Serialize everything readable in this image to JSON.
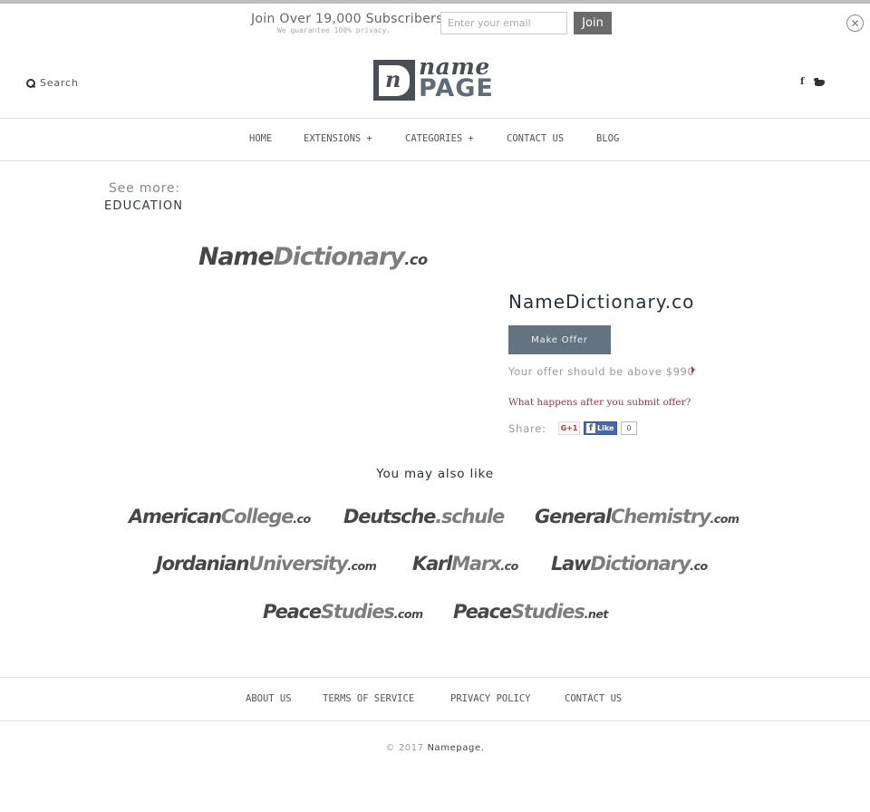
{
  "subscribe": {
    "title": "Join Over 19,000 Subscribers",
    "note": "We guarantee 100% privacy.",
    "email_placeholder": "Enter your email",
    "email_value": "",
    "join_label": "Join",
    "close_icon": "close-circle-icon"
  },
  "header": {
    "search_label": "Search",
    "search_icon": "search-icon",
    "logo": {
      "letter": "n",
      "name": "name",
      "page": "PAGE"
    },
    "social": [
      {
        "name": "facebook",
        "glyph": "f"
      },
      {
        "name": "twitter",
        "icon": "twitter-bird-icon"
      }
    ]
  },
  "nav": {
    "items": [
      {
        "label": "HOME"
      },
      {
        "label": "EXTENSIONS +"
      },
      {
        "label": "CATEGORIES +"
      },
      {
        "label": "CONTACT US"
      },
      {
        "label": "BLOG"
      }
    ]
  },
  "see_more": {
    "label": "See more:",
    "category": "EDUCATION"
  },
  "product": {
    "logo": {
      "primary": "Name",
      "secondary": "Dictionary",
      "tld": ".co"
    },
    "title": "NameDictionary.co",
    "offer_button": "Make Offer",
    "offer_note": "Your offer should be above $990",
    "min_offer": "$990",
    "help_link": "What happens after you submit offer?",
    "share_label": "Share:",
    "gplus_label": "G+1",
    "fb_like_label": "Like",
    "fb_like_count": "0",
    "accent_color": "#637380",
    "link_color": "#a03040"
  },
  "related": {
    "title": "You may also like",
    "items": [
      {
        "primary": "American",
        "secondary": "College",
        "tld": ".co"
      },
      {
        "primary": "Deutsche",
        "secondary": ".schule",
        "tld": ""
      },
      {
        "primary": "General",
        "secondary": "Chemistry",
        "tld": ".com"
      },
      {
        "primary": "Jordanian",
        "secondary": "University",
        "tld": ".com"
      },
      {
        "primary": "Karl",
        "secondary": "Marx",
        "tld": ".co"
      },
      {
        "primary": "Law",
        "secondary": "Dictionary",
        "tld": ".co"
      },
      {
        "primary": "Peace",
        "secondary": "Studies",
        "tld": ".com"
      },
      {
        "primary": "Peace",
        "secondary": "Studies",
        "tld": ".net"
      }
    ]
  },
  "footer": {
    "links": [
      {
        "label": "ABOUT US"
      },
      {
        "label": "TERMS OF SERVICE"
      },
      {
        "label": "PRIVACY POLICY"
      },
      {
        "label": "CONTACT US"
      }
    ],
    "copyright_prefix": "© 2017",
    "copyright_brand": "Namepage."
  }
}
